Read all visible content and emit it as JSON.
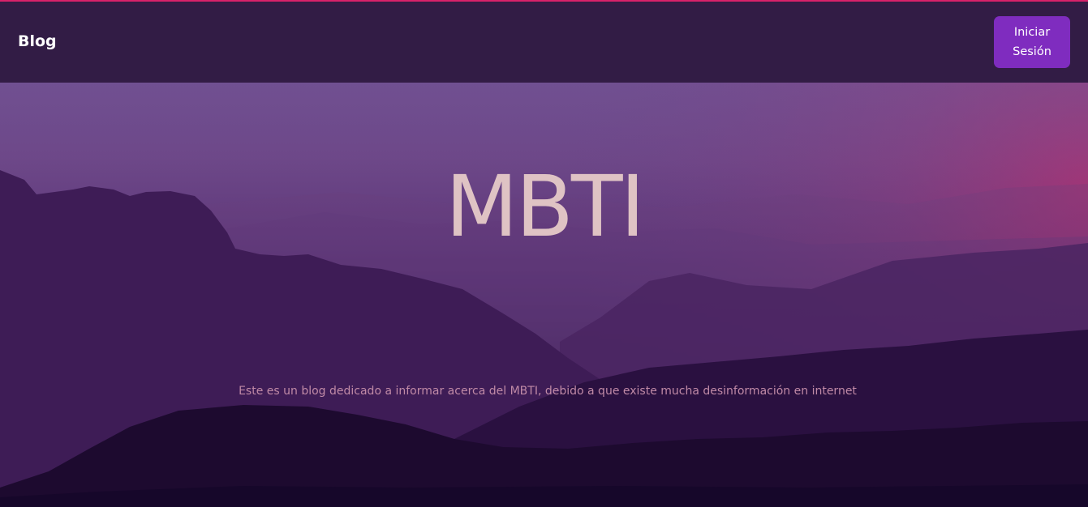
{
  "navbar": {
    "brand": "Blog",
    "login_label": "Iniciar Sesión"
  },
  "hero": {
    "title": "MBTI",
    "description": "Este es un blog dedicado a informar acerca del MBTI, debido a que existe mucha desinformación en internet"
  },
  "colors": {
    "accent_line": "#d8226a",
    "navbar_bg": "#321c45",
    "button_bg": "#7f2cbf",
    "title_color": "#dfc3c4",
    "description_color": "#c08aa6"
  }
}
